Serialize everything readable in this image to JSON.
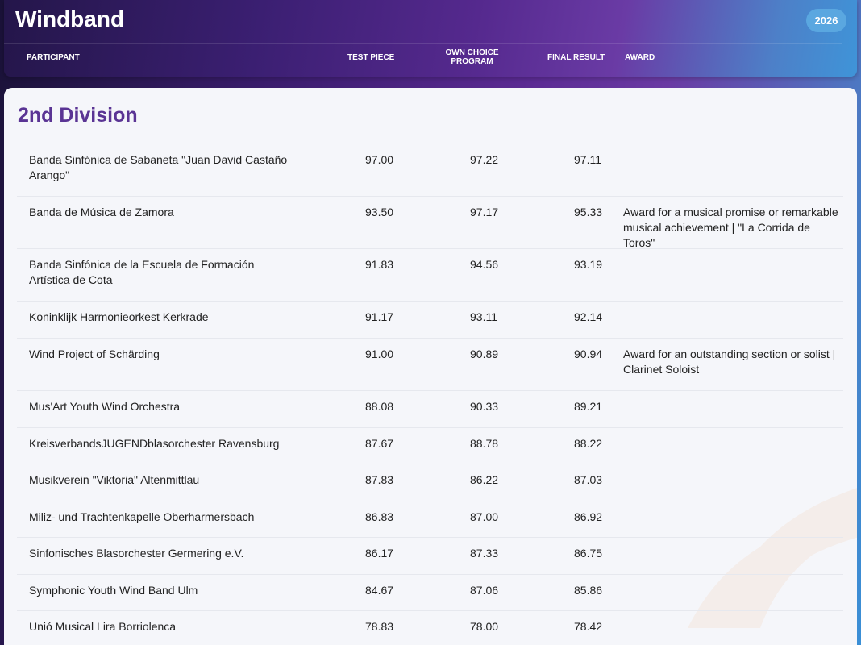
{
  "brand": "Windband",
  "year": "2026",
  "columns": {
    "participant": "PARTICIPANT",
    "test_piece": "TEST PIECE",
    "own_choice_line1": "OWN CHOICE",
    "own_choice_line2": "PROGRAM",
    "final_result": "FINAL RESULT",
    "award": "AWARD"
  },
  "division": {
    "title": "2nd Division"
  },
  "rows": [
    {
      "participant": "Banda Sinfónica de Sabaneta \"Juan David Castaño Arango\"",
      "test_piece": "97.00",
      "own_choice": "97.22",
      "final_result": "97.11",
      "award": ""
    },
    {
      "participant": "Banda de Música de Zamora",
      "test_piece": "93.50",
      "own_choice": "97.17",
      "final_result": "95.33",
      "award": "Award for a musical promise or remarkable musical achievement | \"La Corrida de Toros\""
    },
    {
      "participant": "Banda Sinfónica de la Escuela de Formación Artística de Cota",
      "test_piece": "91.83",
      "own_choice": "94.56",
      "final_result": "93.19",
      "award": ""
    },
    {
      "participant": "Koninklijk Harmonieorkest Kerkrade",
      "test_piece": "91.17",
      "own_choice": "93.11",
      "final_result": "92.14",
      "award": ""
    },
    {
      "participant": "Wind Project of Schärding",
      "test_piece": "91.00",
      "own_choice": "90.89",
      "final_result": "90.94",
      "award": "Award for an outstanding section or solist | Clarinet Soloist"
    },
    {
      "participant": "Mus'Art Youth Wind Orchestra",
      "test_piece": "88.08",
      "own_choice": "90.33",
      "final_result": "89.21",
      "award": ""
    },
    {
      "participant": "KreisverbandsJUGENDblasorchester Ravensburg",
      "test_piece": "87.67",
      "own_choice": "88.78",
      "final_result": "88.22",
      "award": ""
    },
    {
      "participant": "Musikverein \"Viktoria\" Altenmittlau",
      "test_piece": "87.83",
      "own_choice": "86.22",
      "final_result": "87.03",
      "award": ""
    },
    {
      "participant": "Miliz- und Trachtenkapelle Oberharmersbach",
      "test_piece": "86.83",
      "own_choice": "87.00",
      "final_result": "86.92",
      "award": ""
    },
    {
      "participant": "Sinfonisches Blasorchester Germering e.V.",
      "test_piece": "86.17",
      "own_choice": "87.33",
      "final_result": "86.75",
      "award": ""
    },
    {
      "participant": "Symphonic Youth Wind Band Ulm",
      "test_piece": "84.67",
      "own_choice": "87.06",
      "final_result": "85.86",
      "award": ""
    },
    {
      "participant": "Unió Musical Lira Borriolenca",
      "test_piece": "78.83",
      "own_choice": "78.00",
      "final_result": "78.42",
      "award": ""
    }
  ]
}
